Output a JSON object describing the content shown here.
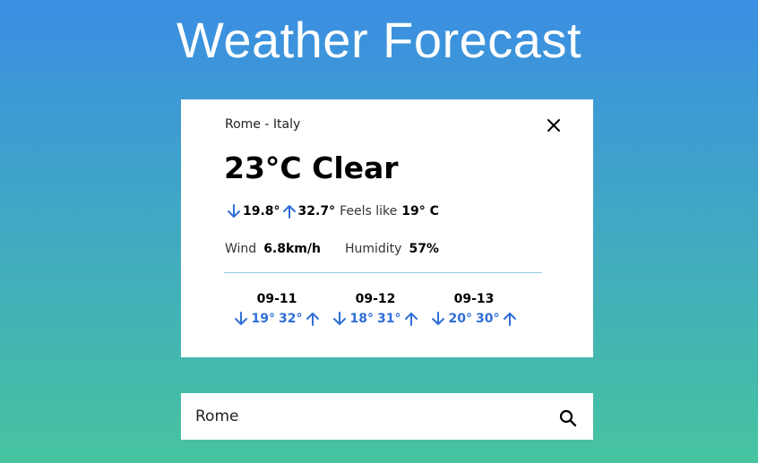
{
  "app": {
    "title": "Weather Forecast"
  },
  "current": {
    "location": "Rome - Italy",
    "summary": "23°C Clear",
    "min": "19.8°",
    "max": "32.7°",
    "feels_like_label": "Feels like",
    "feels_like_value": "19° C",
    "wind_label": "Wind",
    "wind_value": "6.8km/h",
    "humidity_label": "Humidity",
    "humidity_value": "57%"
  },
  "forecast": [
    {
      "date": "09-11",
      "min": "19°",
      "max": "32°"
    },
    {
      "date": "09-12",
      "min": "18°",
      "max": "31°"
    },
    {
      "date": "09-13",
      "min": "20°",
      "max": "30°"
    }
  ],
  "search": {
    "value": "Rome"
  },
  "colors": {
    "accent": "#2f6ed6",
    "bg_top": "#3b8ee3",
    "bg_bottom": "#46c4a0"
  },
  "icons": {
    "close": "close-icon",
    "down": "arrow-down-icon",
    "up": "arrow-up-icon",
    "search": "search-icon"
  }
}
